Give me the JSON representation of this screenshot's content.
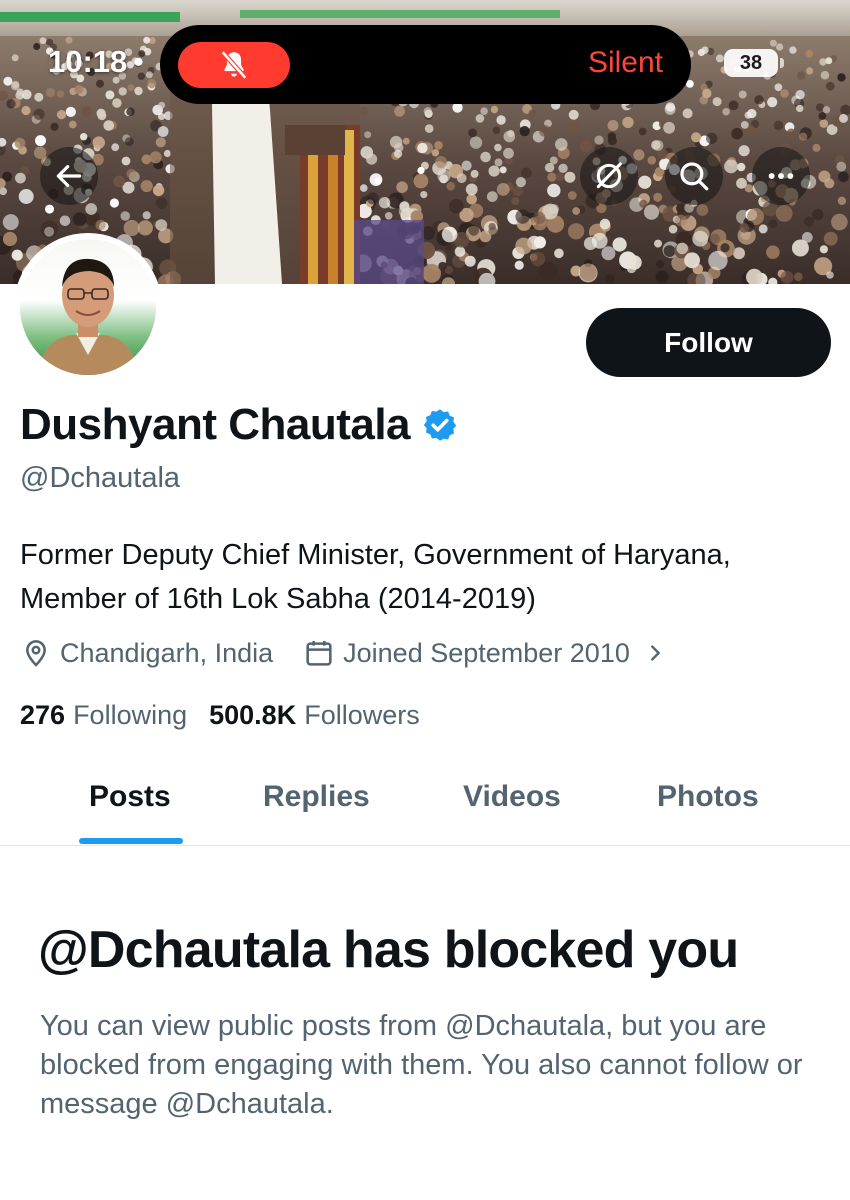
{
  "status_bar": {
    "time": "10:18",
    "mode_label": "Silent",
    "battery": "38",
    "mode_icon": "bell-slash-icon"
  },
  "header": {
    "back_icon": "arrow-left-icon",
    "grok_icon": "grok-icon",
    "search_icon": "search-icon",
    "more_icon": "more-horizontal-icon"
  },
  "profile": {
    "display_name": "Dushyant Chautala",
    "handle": "@Dchautala",
    "verified": true,
    "bio": "Former Deputy Chief Minister, Government of Haryana, Member of 16th Lok Sabha (2014-2019)",
    "location": "Chandigarh, India",
    "joined": "Joined September 2010",
    "following_count": "276",
    "following_label": "Following",
    "followers_count": "500.8K",
    "followers_label": "Followers",
    "follow_button_label": "Follow"
  },
  "tabs": [
    {
      "label": "Posts",
      "active": true
    },
    {
      "label": "Replies",
      "active": false
    },
    {
      "label": "Videos",
      "active": false
    },
    {
      "label": "Photos",
      "active": false
    }
  ],
  "blocked": {
    "title": "@Dchautala has blocked you",
    "body": "You can view public posts from @Dchautala, but you are blocked from engaging with them. You also cannot follow or message @Dchautala."
  },
  "colors": {
    "accent": "#1d9bf0",
    "text_primary": "#0f1419",
    "text_secondary": "#536471",
    "silent_red": "#ff3b30"
  }
}
